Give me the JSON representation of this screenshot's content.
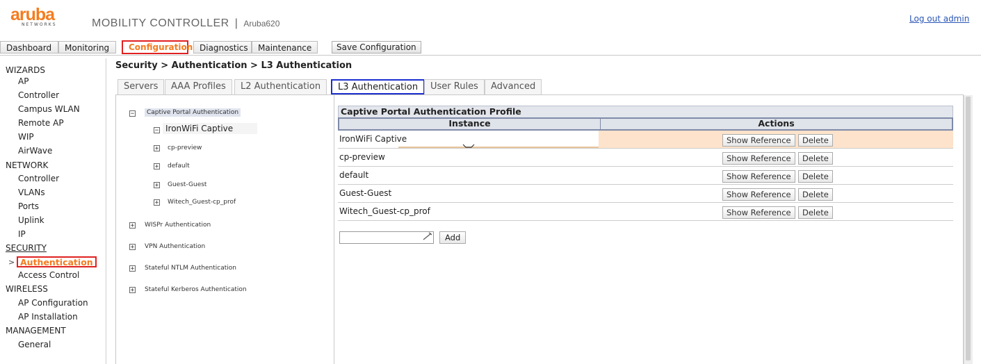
{
  "header": {
    "logo_text": "aruba",
    "logo_subtext": "NETWORKS",
    "product": "MOBILITY CONTROLLER",
    "separator": "|",
    "model": "Aruba620",
    "logout": "Log out admin"
  },
  "topnav": {
    "tabs": [
      "Dashboard",
      "Monitoring",
      "Configuration",
      "Diagnostics",
      "Maintenance"
    ],
    "active": "Configuration",
    "save_label": "Save Configuration"
  },
  "sidebar": {
    "wizards": {
      "heading": "WIZARDS",
      "items": [
        "AP",
        "Controller",
        "Campus WLAN",
        "Remote AP",
        "WIP",
        "AirWave"
      ]
    },
    "network": {
      "heading": "NETWORK",
      "items": [
        "Controller",
        "VLANs",
        "Ports",
        "Uplink",
        "IP"
      ]
    },
    "security": {
      "heading": "SECURITY",
      "marker": ">",
      "active_item": "Authentication",
      "items": [
        "Access Control"
      ]
    },
    "wireless": {
      "heading": "WIRELESS",
      "items": [
        "AP Configuration",
        "AP Installation"
      ]
    },
    "management": {
      "heading": "MANAGEMENT",
      "items": [
        "General"
      ]
    }
  },
  "breadcrumb": "Security > Authentication > L3 Authentication",
  "subtabs": {
    "items": [
      "Servers",
      "AAA Profiles",
      "L2 Authentication",
      "L3 Authentication",
      "User Rules",
      "Advanced"
    ],
    "active": "L3 Authentication"
  },
  "tree": {
    "captive": {
      "label": "Captive Portal Authentication",
      "toggle": "−"
    },
    "ironwifi": {
      "label": "IronWiFi Captive",
      "toggle": "−"
    },
    "children": [
      {
        "label": "cp-preview",
        "toggle": "+"
      },
      {
        "label": "default",
        "toggle": "+"
      },
      {
        "label": "Guest-Guest",
        "toggle": "+"
      },
      {
        "label": "Witech_Guest-cp_prof",
        "toggle": "+"
      }
    ],
    "others": [
      {
        "label": "WISPr Authentication",
        "toggle": "+"
      },
      {
        "label": "VPN Authentication",
        "toggle": "+"
      },
      {
        "label": "Stateful NTLM Authentication",
        "toggle": "+"
      },
      {
        "label": "Stateful Kerberos Authentication",
        "toggle": "+"
      }
    ]
  },
  "profile_table": {
    "title": "Captive Portal Authentication Profile",
    "col_instance": "Instance",
    "col_actions": "Actions",
    "rows": [
      {
        "name": "IronWiFi Captive",
        "selected": true
      },
      {
        "name": "cp-preview",
        "selected": false
      },
      {
        "name": "default",
        "selected": false
      },
      {
        "name": "Guest-Guest",
        "selected": false
      },
      {
        "name": "Witech_Guest-cp_prof",
        "selected": false
      }
    ],
    "show_reference": "Show Reference",
    "delete": "Delete",
    "add_label": "Add",
    "new_instance_value": ""
  },
  "colors": {
    "accent": "#f47c20",
    "active_nav_border": "#e02020",
    "active_subtab_border": "#1a2fd0",
    "selected_row": "#fde3cb",
    "link": "#2a55b5"
  }
}
